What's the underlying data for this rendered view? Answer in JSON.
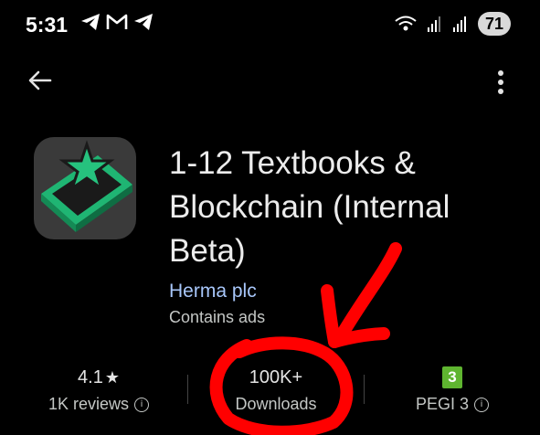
{
  "status_bar": {
    "time": "5:31",
    "battery": "71",
    "left_icons": [
      "telegram-icon",
      "gmail-icon",
      "telegram-icon"
    ],
    "right_icons": [
      "wifi-icon",
      "signal-icon",
      "signal-icon"
    ]
  },
  "app": {
    "title_lines": [
      "1-12 Textbooks &",
      "Blockchain (Internal",
      "Beta)"
    ],
    "developer": "Herma plc",
    "contains_ads": "Contains ads",
    "icon_colors": {
      "background": "#3a3a3a",
      "book": "#1fb573",
      "star": "#26c27e"
    }
  },
  "stats": {
    "rating": {
      "value": "4.1",
      "star": "★",
      "label": "1K reviews"
    },
    "downloads": {
      "value": "100K+",
      "label": "Downloads"
    },
    "pegi": {
      "badge": "3",
      "label": "PEGI 3"
    }
  },
  "colors": {
    "accent_link": "#a8c7fa",
    "annotation": "#ff0000",
    "pegi_green": "#5fb530"
  }
}
